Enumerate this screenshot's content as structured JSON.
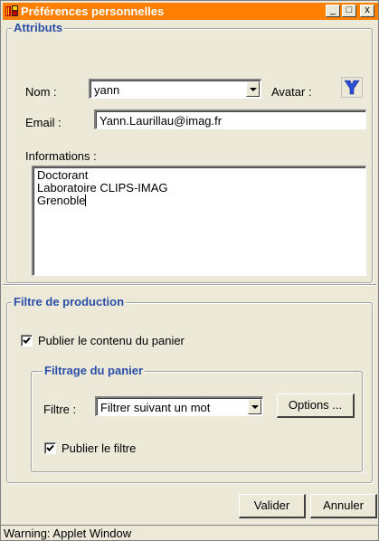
{
  "window": {
    "title": "Préférences personnelles",
    "controls": {
      "minimize": "_",
      "maximize": "□",
      "close": "x"
    }
  },
  "attributs": {
    "legend": "Attributs",
    "nom_label": "Nom :",
    "nom_value": "yann",
    "avatar_label": "Avatar :",
    "avatar_icon": "avatar-y-icon",
    "email_label": "Email :",
    "email_value": "Yann.Laurillau@imag.fr",
    "informations_label": "Informations :",
    "informations_lines": [
      "Doctorant",
      "Laboratoire CLIPS-IMAG",
      "Grenoble"
    ]
  },
  "filtre_production": {
    "legend": "Filtre de production",
    "publier_contenu_label": "Publier le contenu du panier",
    "publier_contenu_checked": true,
    "filtrage": {
      "legend": "Filtrage du panier",
      "filtre_label": "Filtre :",
      "filtre_value": "Filtrer suivant un mot",
      "options_button": "Options ...",
      "publier_filtre_label": "Publier le filtre",
      "publier_filtre_checked": true
    }
  },
  "actions": {
    "valider": "Valider",
    "annuler": "Annuler"
  },
  "status": "Warning: Applet Window",
  "colors": {
    "titlebar": "#ff7f00",
    "legend": "#2a4fa8",
    "face": "#ece9d8"
  }
}
